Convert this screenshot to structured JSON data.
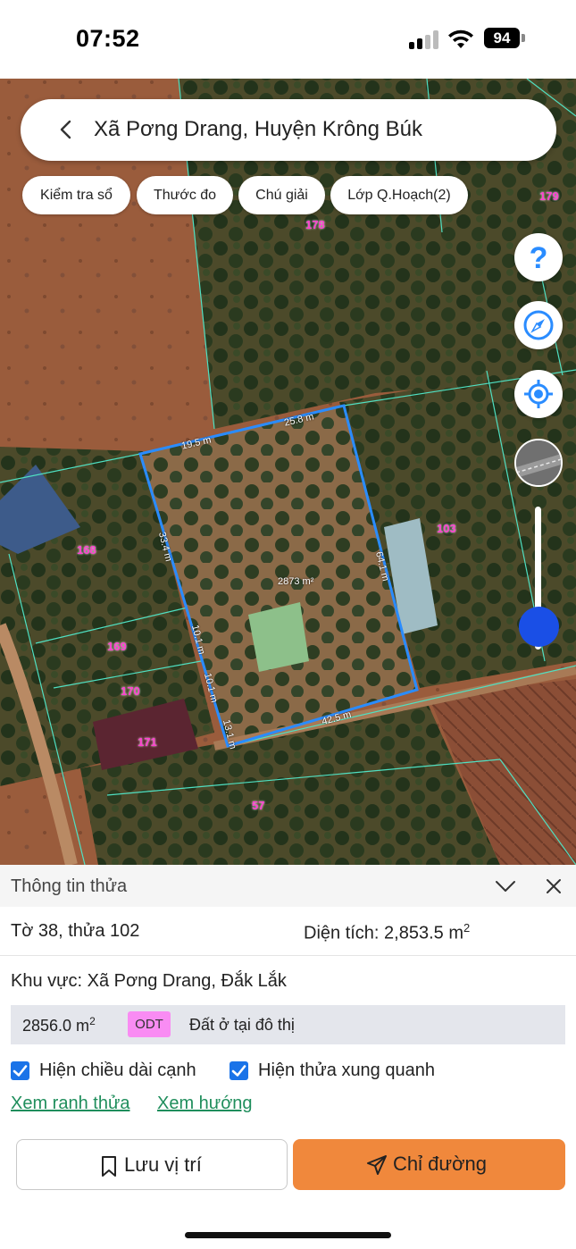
{
  "status_bar": {
    "time": "07:52",
    "battery": "94"
  },
  "search": {
    "title": "Xã Pơng Drang, Huyện Krông Búk"
  },
  "chips": [
    "Kiểm tra sổ",
    "Thước đo",
    "Chú giải",
    "Lớp Q.Hoạch(2)"
  ],
  "map_controls": {
    "help_icon": "question-icon",
    "compass_icon": "compass-icon",
    "locate_icon": "locate-icon",
    "layer_icon": "satellite-layer-thumbnail",
    "zoom_level": 0.16
  },
  "map": {
    "parcel_labels": [
      "179",
      "178",
      "103",
      "168",
      "169",
      "170",
      "171",
      "57"
    ],
    "edge_labels": [
      "25.8 m",
      "19.5 m",
      "33.4 m",
      "64.1 m",
      "10.1 m",
      "10.1 m",
      "13.1 m",
      "42.5 m"
    ],
    "parcel_area": "2873 m²",
    "boundary_color": "#2a8cff",
    "label_color": "#ff3fd0"
  },
  "sheet": {
    "title": "Thông tin thửa",
    "collapse_icon": "chevron-down-icon",
    "close_icon": "close-icon",
    "parcel_id": "Tờ 38, thửa 102",
    "area_label": "Diện tích: 2,853.5 m",
    "area_sup": "2",
    "region": "Khu vực: Xã Pơng Drang, Đắk Lắk",
    "land_area": "2856.0 m",
    "land_area_sup": "2",
    "land_code": "ODT",
    "land_desc": "Đất ở tại đô thị",
    "check_edges": "Hiện chiều dài cạnh",
    "check_neighbors": "Hiện thửa xung quanh",
    "link_boundary": "Xem ranh thửa",
    "link_direction": "Xem hướng",
    "btn_save": "Lưu vị trí",
    "btn_directions": "Chỉ đường",
    "accent": "#f0883c",
    "link_color": "#1f8e5c",
    "badge_color": "#f98cf3"
  }
}
